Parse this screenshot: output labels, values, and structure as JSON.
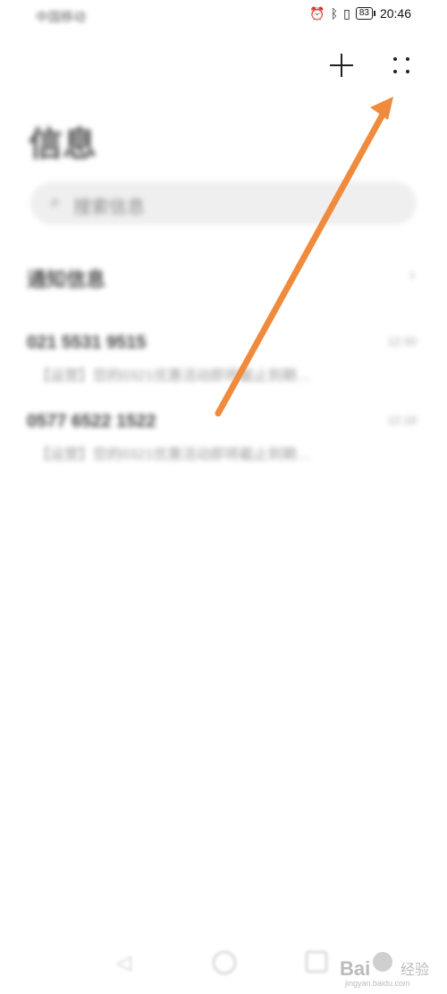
{
  "status_bar": {
    "carrier": "中国移动",
    "battery": "83",
    "time": "20:46"
  },
  "header": {
    "title": "信息",
    "add_icon": "plus-icon",
    "more_icon": "more-dots-icon"
  },
  "search": {
    "placeholder": "搜索信息"
  },
  "notifications": {
    "label": "通知信息",
    "chevron": "›"
  },
  "messages": [
    {
      "number": "021 5531 9515",
      "time": "12:30",
      "preview": "【运营】您的0321优惠活动即将截止到期…"
    },
    {
      "number": "0577 6522 1522",
      "time": "12:18",
      "preview": "【运营】您的0321优惠活动即将截止到期…"
    }
  ],
  "watermark": {
    "logo": "Bai",
    "logo_tail": "经验",
    "url": "jingyan.baidu.com"
  },
  "annotation": {
    "color": "#F08A3C"
  }
}
